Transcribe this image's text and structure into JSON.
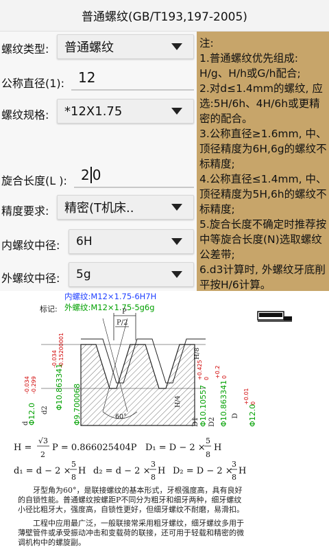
{
  "app": {
    "title": "普通螺纹(GB/T193,197-2005)"
  },
  "form": {
    "thread_type": {
      "label": "螺纹类型:",
      "value": "普通螺纹"
    },
    "nominal_diameter": {
      "label": "公称直径(1):",
      "value": "12"
    },
    "spec": {
      "label": "螺纹规格:",
      "value": "*12X1.75"
    },
    "engagement_length": {
      "label": "旋合长度(L ):",
      "value_before_cursor": "2",
      "value_after_cursor": "0"
    },
    "precision": {
      "label": "精度要求:",
      "value": "精密(T机床.."
    },
    "internal_pitch": {
      "label": "内螺纹中径:",
      "value": "6H"
    },
    "external_pitch": {
      "label": "外螺纹中径:",
      "value": "5g"
    }
  },
  "notes": {
    "heading": "注:",
    "items": [
      " 1.普通螺纹优先组成: H/g、H/h或G/h配合;",
      " 2.对d≤1.4mm的螺纹, 应选:5H/6h、4H/6h或更精密的配合。",
      " 3.公称直径≥1.6mm, 中、顶径精度为6H,6g的螺纹不标精度;",
      " 4.公称直径≤1.4mm, 中、顶径精度为5H,6h的螺纹不标精度;",
      " 5.旋合长度不确定时推荐按中等旋合长度(N)选取螺纹公差带;",
      " 6.d3计算时, 外螺纹牙底削平按H/6计算。"
    ]
  },
  "diagram": {
    "mark_label": "标记:",
    "internal_mark": "内螺纹:M12×1.75-6H7H",
    "external_mark": "外螺纹:M12×1.75-5g6g",
    "pitch_label": "P",
    "half_pitch_label": "P/2",
    "angle_label": "60°",
    "h8_label": "H/8",
    "h4_label": "H/4",
    "dims": {
      "d": "d",
      "d2": "d2",
      "d1_label": "D1",
      "d2_label": "D2",
      "D": "D",
      "d_major_value": "Φ12.0",
      "d_major_tol_top": "-0.034",
      "d_major_tol_bottom": "-0.299",
      "d2_value": "Φ10.863341",
      "d2_tol_top": "-0.034",
      "d2_tol_bottom": "-0.15200001",
      "d1_value": "Φ9.700068",
      "D1_value": "Φ10.10557",
      "D1_tol_top": "+0.425",
      "D1_tol_bottom": "0",
      "D2_value": "Φ10.863341",
      "D2_tol_top": "+0.2",
      "D2_tol_bottom": "0",
      "D_value": "Φ12.0",
      "D_tol_top": "+0.01",
      "D_tol_bottom": "0"
    },
    "formula_line1": {
      "lhs": "H =",
      "frac_num": "√3",
      "frac_den": "2",
      "rest": "P = 0.866025404P",
      "rhs_lhs": "D₁ = D − 2 ×",
      "rhs_num": "5",
      "rhs_den": "8",
      "rhs_rest": "H"
    },
    "formula_line2": {
      "a_lhs": "d₁ = d − 2 ×",
      "a_num": "5",
      "a_den": "8",
      "a_rest": "H",
      "b_lhs": "d₂ = d − 2 ×",
      "b_num": "3",
      "b_den": "8",
      "b_rest": "H",
      "c_lhs": "D₂ = D − 2 ×",
      "c_num": "3",
      "c_den": "8",
      "c_rest": "H"
    },
    "desc1": "牙型角为60°，是联接螺纹的基本形式，牙根强度高，具有良好的自锁性能。普通螺纹按螺距P不同分为粗牙和细牙两种，细牙螺纹小径比粗牙大，强度高，自锁性更好，但细牙螺纹不耐磨，易滑扣。",
    "desc2": "工程中应用最广泛，一般联接常采用粗牙螺纹，细牙螺纹多用于薄壁管件或承受振动冲击和变载荷的联接，还可用于轻载和精密的微调机构中的螺旋副。"
  },
  "colors": {
    "accent_green": "#00a000",
    "accent_blue": "#2040ff",
    "accent_red": "#d00000",
    "notes_bg": "#c7a56a"
  }
}
